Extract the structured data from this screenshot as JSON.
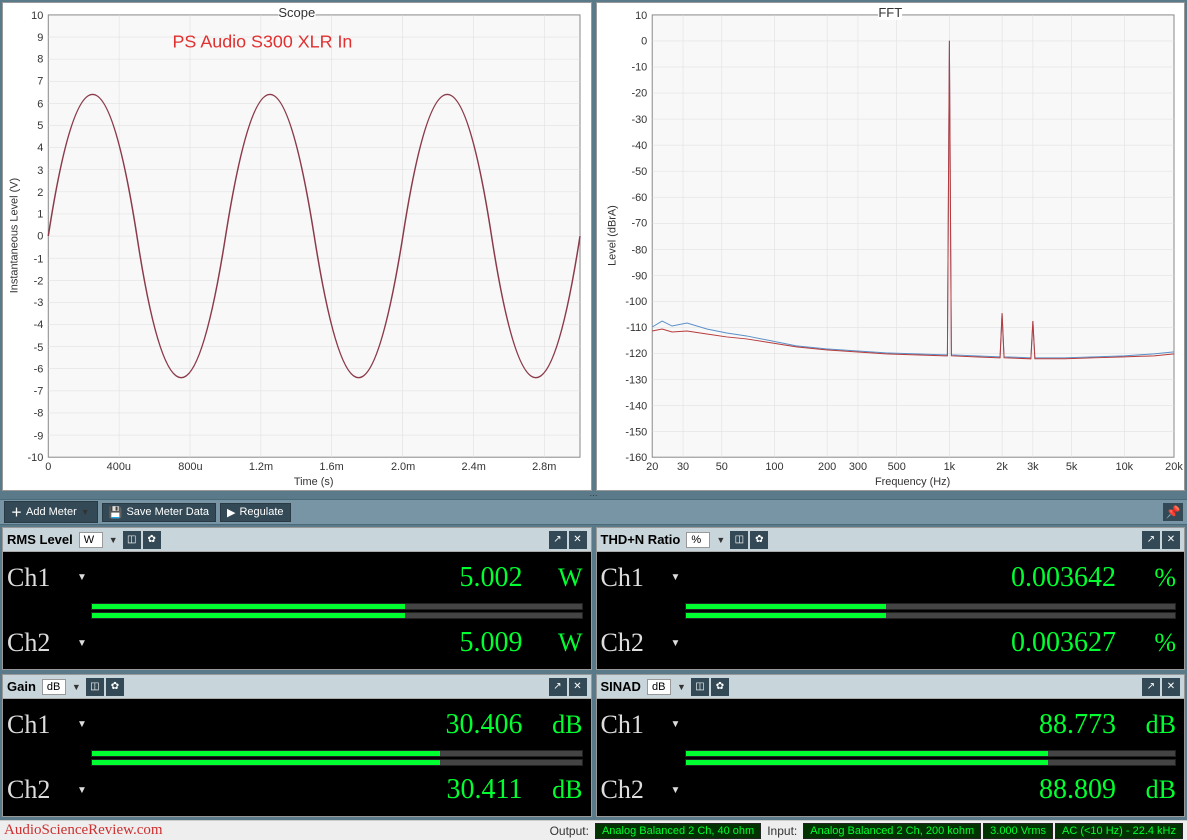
{
  "annotation": "PS Audio S300 XLR In",
  "chart_data": [
    {
      "type": "line",
      "title": "Scope",
      "xlabel": "Time (s)",
      "ylabel": "Instantaneous Level (V)",
      "xlim": [
        0,
        0.003
      ],
      "ylim": [
        -10,
        10
      ],
      "xticks": [
        "0",
        "400u",
        "800u",
        "1.2m",
        "1.6m",
        "2.0m",
        "2.4m",
        "2.8m"
      ],
      "yticks": [
        -10,
        -9,
        -8,
        -7,
        -6,
        -5,
        -4,
        -3,
        -2,
        -1,
        0,
        1,
        2,
        3,
        4,
        5,
        6,
        7,
        8,
        9,
        10
      ],
      "series": [
        {
          "name": "sine",
          "amplitude": 6.4,
          "frequency_hz": 1000,
          "phase": 0
        }
      ]
    },
    {
      "type": "line",
      "title": "FFT",
      "xlabel": "Frequency (Hz)",
      "ylabel": "Level (dBrA)",
      "xscale": "log",
      "xlim": [
        20,
        20000
      ],
      "ylim": [
        -160,
        10
      ],
      "xticks": [
        "20",
        "30",
        "50",
        "100",
        "200",
        "300",
        "500",
        "1k",
        "2k",
        "3k",
        "5k",
        "10k",
        "20k"
      ],
      "yticks": [
        10,
        0,
        -10,
        -20,
        -30,
        -40,
        -50,
        -60,
        -70,
        -80,
        -90,
        -100,
        -110,
        -120,
        -130,
        -140,
        -150,
        -160
      ],
      "series": [
        {
          "name": "Ch1",
          "color": "#5a90c8",
          "noise_floor_db": -125,
          "peaks": [
            {
              "hz": 1000,
              "db": 0
            },
            {
              "hz": 2000,
              "db": -104
            },
            {
              "hz": 3000,
              "db": -108
            }
          ]
        },
        {
          "name": "Ch2",
          "color": "#b83a3a",
          "noise_floor_db": -125,
          "peaks": [
            {
              "hz": 1000,
              "db": 0
            },
            {
              "hz": 2000,
              "db": -104
            },
            {
              "hz": 3000,
              "db": -108
            }
          ]
        }
      ]
    }
  ],
  "toolbar": {
    "add_meter": "Add Meter",
    "save_meter": "Save Meter Data",
    "regulate": "Regulate"
  },
  "meters": [
    {
      "title": "RMS Level",
      "unit": "W",
      "channels": [
        {
          "label": "Ch1",
          "value": "5.002",
          "unit": "W",
          "bar_pct": 64
        },
        {
          "label": "Ch2",
          "value": "5.009",
          "unit": "W",
          "bar_pct": 64
        }
      ]
    },
    {
      "title": "THD+N Ratio",
      "unit": "%",
      "channels": [
        {
          "label": "Ch1",
          "value": "0.003642",
          "unit": "%",
          "bar_pct": 41
        },
        {
          "label": "Ch2",
          "value": "0.003627",
          "unit": "%",
          "bar_pct": 41
        }
      ]
    },
    {
      "title": "Gain",
      "unit": "dB",
      "channels": [
        {
          "label": "Ch1",
          "value": "30.406",
          "unit": "dB",
          "bar_pct": 71
        },
        {
          "label": "Ch2",
          "value": "30.411",
          "unit": "dB",
          "bar_pct": 71
        }
      ]
    },
    {
      "title": "SINAD",
      "unit": "dB",
      "channels": [
        {
          "label": "Ch1",
          "value": "88.773",
          "unit": "dB",
          "bar_pct": 74
        },
        {
          "label": "Ch2",
          "value": "88.809",
          "unit": "dB",
          "bar_pct": 74
        }
      ]
    }
  ],
  "statusbar": {
    "watermark": "AudioScienceReview.com",
    "output_label": "Output:",
    "output_val": "Analog Balanced 2 Ch, 40 ohm",
    "input_label": "Input:",
    "input_val": "Analog Balanced 2 Ch, 200 kohm",
    "vrms": "3.000 Vrms",
    "bandwidth": "AC (<10 Hz) - 22.4 kHz"
  }
}
